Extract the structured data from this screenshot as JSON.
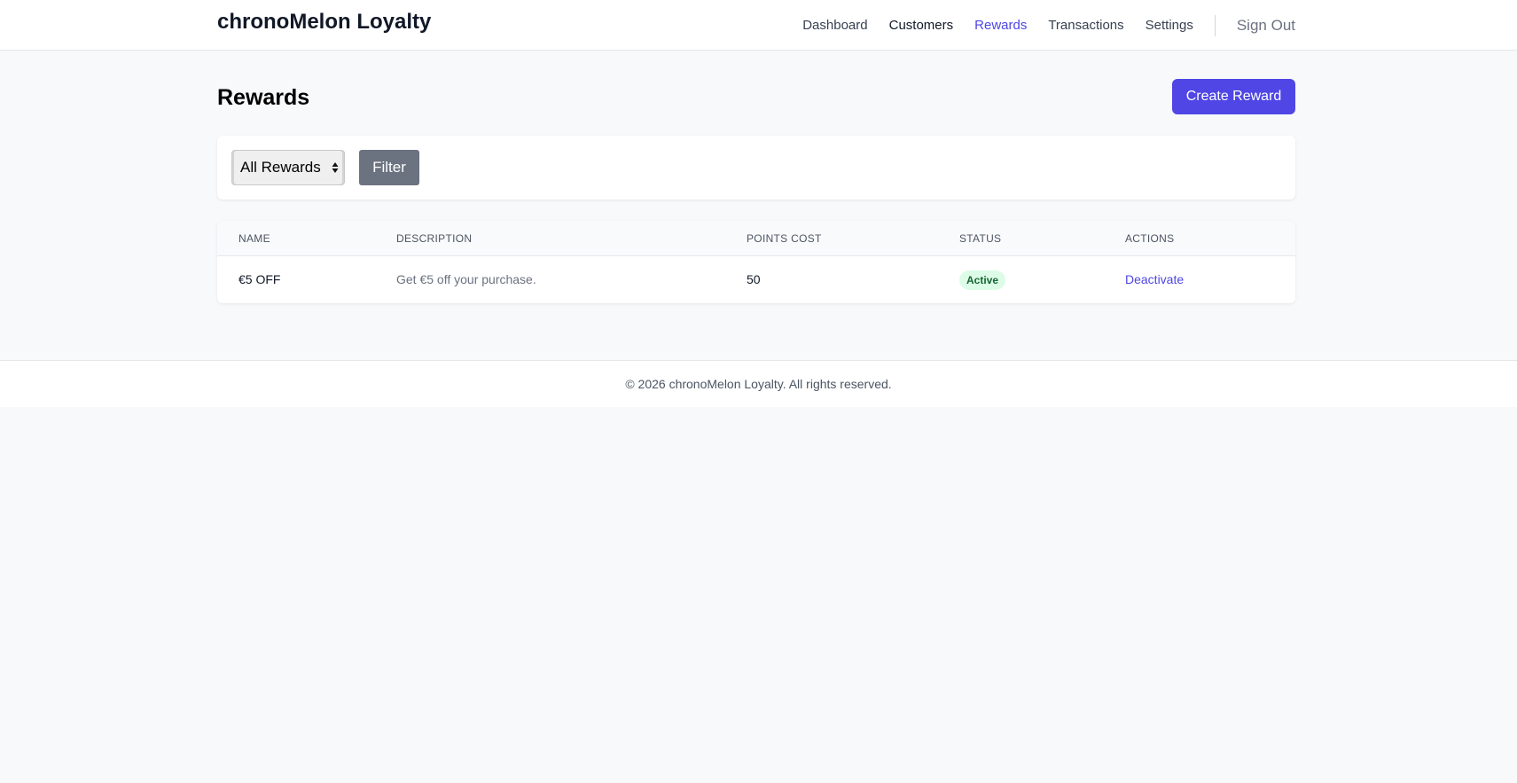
{
  "header": {
    "brand": "chronoMelon Loyalty",
    "nav": {
      "dashboard": "Dashboard",
      "customers": "Customers",
      "rewards": "Rewards",
      "transactions": "Transactions",
      "settings": "Settings"
    },
    "sign_out": "Sign Out",
    "active_color": "#4f46e5"
  },
  "main": {
    "title": "Rewards",
    "create_button": "Create Reward",
    "filter": {
      "select_value": "All Rewards",
      "button": "Filter"
    },
    "table": {
      "columns": [
        "NAME",
        "DESCRIPTION",
        "POINTS COST",
        "STATUS",
        "ACTIONS"
      ],
      "rows": [
        {
          "name": "€5 OFF",
          "description": "Get €5 off your purchase.",
          "points_cost": "50",
          "status": "Active",
          "action": "Deactivate"
        }
      ]
    }
  },
  "footer": {
    "text": "© 2026 chronoMelon Loyalty. All rights reserved."
  },
  "colors": {
    "primary": "#4f46e5",
    "status_active_bg": "#dcfce7",
    "status_active_text": "#166534",
    "secondary_button": "#6b7280"
  }
}
